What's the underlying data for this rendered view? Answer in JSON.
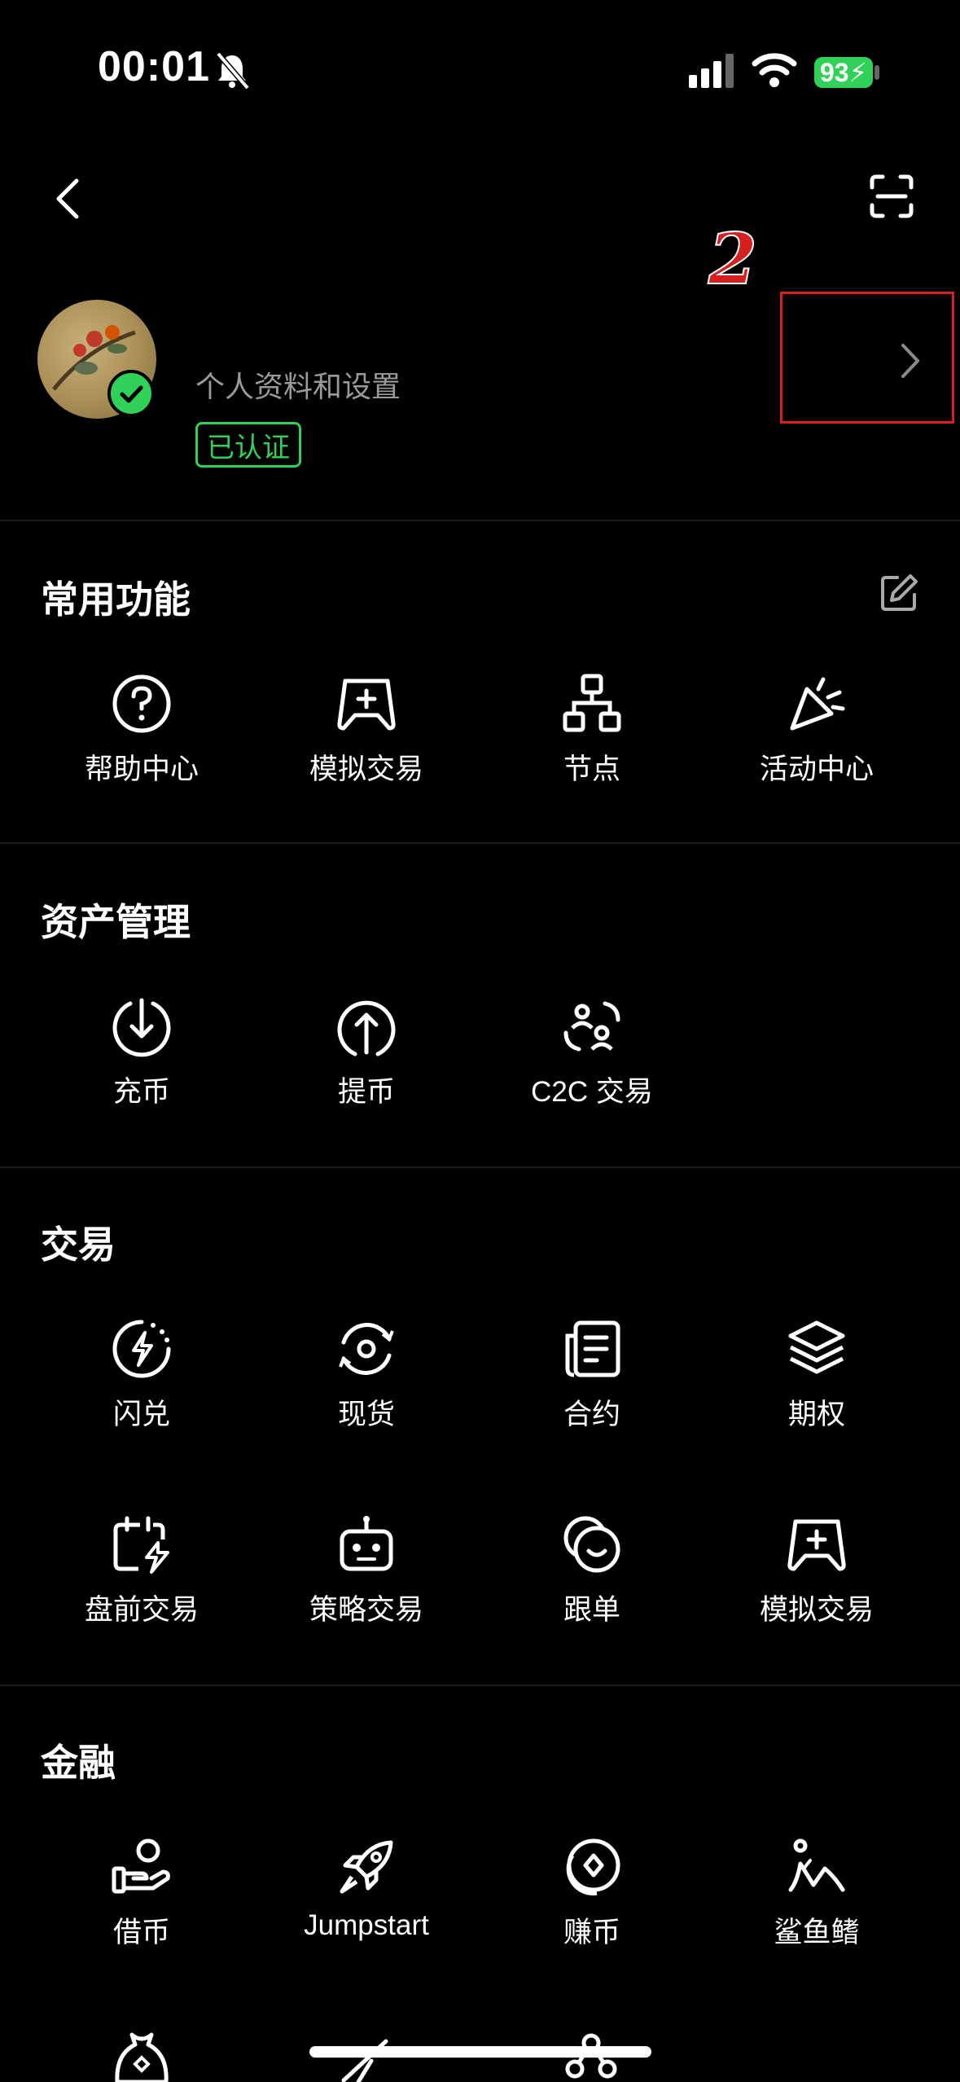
{
  "status_bar": {
    "time": "00:01",
    "battery": "93"
  },
  "profile": {
    "subtitle": "个人资料和设置",
    "verified_label": "已认证"
  },
  "annotation": {
    "number": "2"
  },
  "sections": {
    "common": {
      "title": "常用功能",
      "items": [
        "帮助中心",
        "模拟交易",
        "节点",
        "活动中心"
      ]
    },
    "assets": {
      "title": "资产管理",
      "items": [
        "充币",
        "提币",
        "C2C 交易"
      ]
    },
    "trade": {
      "title": "交易",
      "items": [
        "闪兑",
        "现货",
        "合约",
        "期权",
        "盘前交易",
        "策略交易",
        "跟单",
        "模拟交易"
      ]
    },
    "finance": {
      "title": "金融",
      "items": [
        "借币",
        "Jumpstart",
        "赚币",
        "鲨鱼鳍"
      ]
    }
  }
}
